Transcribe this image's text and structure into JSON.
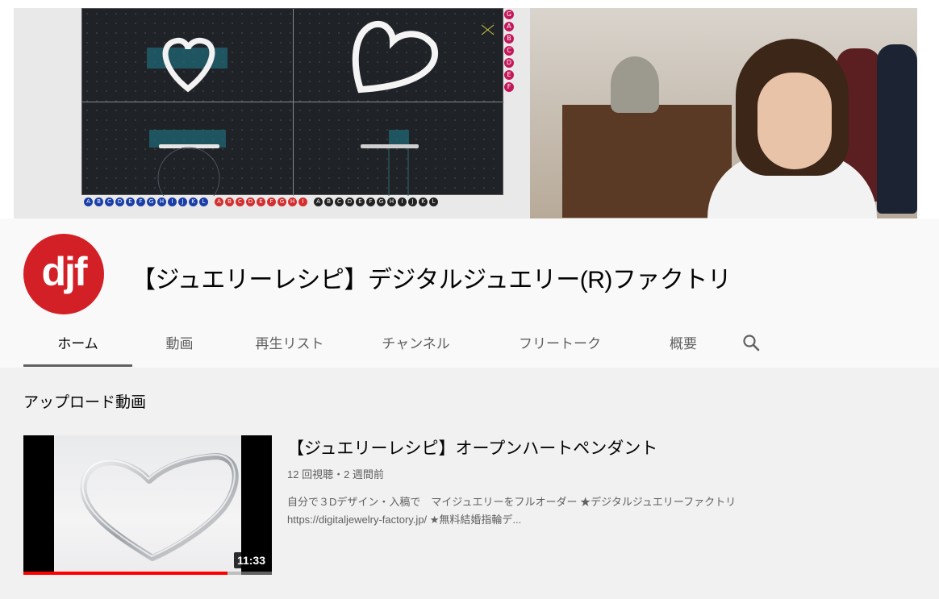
{
  "banner": {
    "right_letters": [
      "G",
      "A",
      "B",
      "C",
      "D",
      "E",
      "F"
    ],
    "bottom_blue": [
      "A",
      "B",
      "C",
      "D",
      "E",
      "F",
      "G",
      "H",
      "I",
      "J",
      "K",
      "L"
    ],
    "bottom_red": [
      "A",
      "B",
      "C",
      "D",
      "E",
      "F",
      "G",
      "H",
      "I"
    ],
    "bottom_black": [
      "A",
      "B",
      "C",
      "D",
      "E",
      "F",
      "G",
      "H",
      "I",
      "J",
      "K",
      "L"
    ]
  },
  "channel": {
    "avatar_text": "djf",
    "title": "【ジュエリーレシピ】デジタルジュエリー(R)ファクトリ",
    "brand_color": "#d32027"
  },
  "tabs": [
    {
      "label": "ホーム",
      "active": true
    },
    {
      "label": "動画"
    },
    {
      "label": "再生リスト"
    },
    {
      "label": "チャンネル"
    },
    {
      "label": "フリートーク"
    },
    {
      "label": "概要"
    }
  ],
  "search_icon": "search-icon",
  "section": {
    "title": "アップロード動画"
  },
  "video": {
    "title": "【ジュエリーレシピ】オープンハートペンダント",
    "stats": "12 回視聴・2 週間前",
    "desc_line1": "自分で３Dデザイン・入稿で　マイジュエリーをフルオーダー ★デジタルジュエリーファクトリ",
    "desc_line2": "https://digitaljewelry-factory.jp/ ★無料結婚指輪デ...",
    "duration": "11:33",
    "watched_fraction": 0.82
  }
}
